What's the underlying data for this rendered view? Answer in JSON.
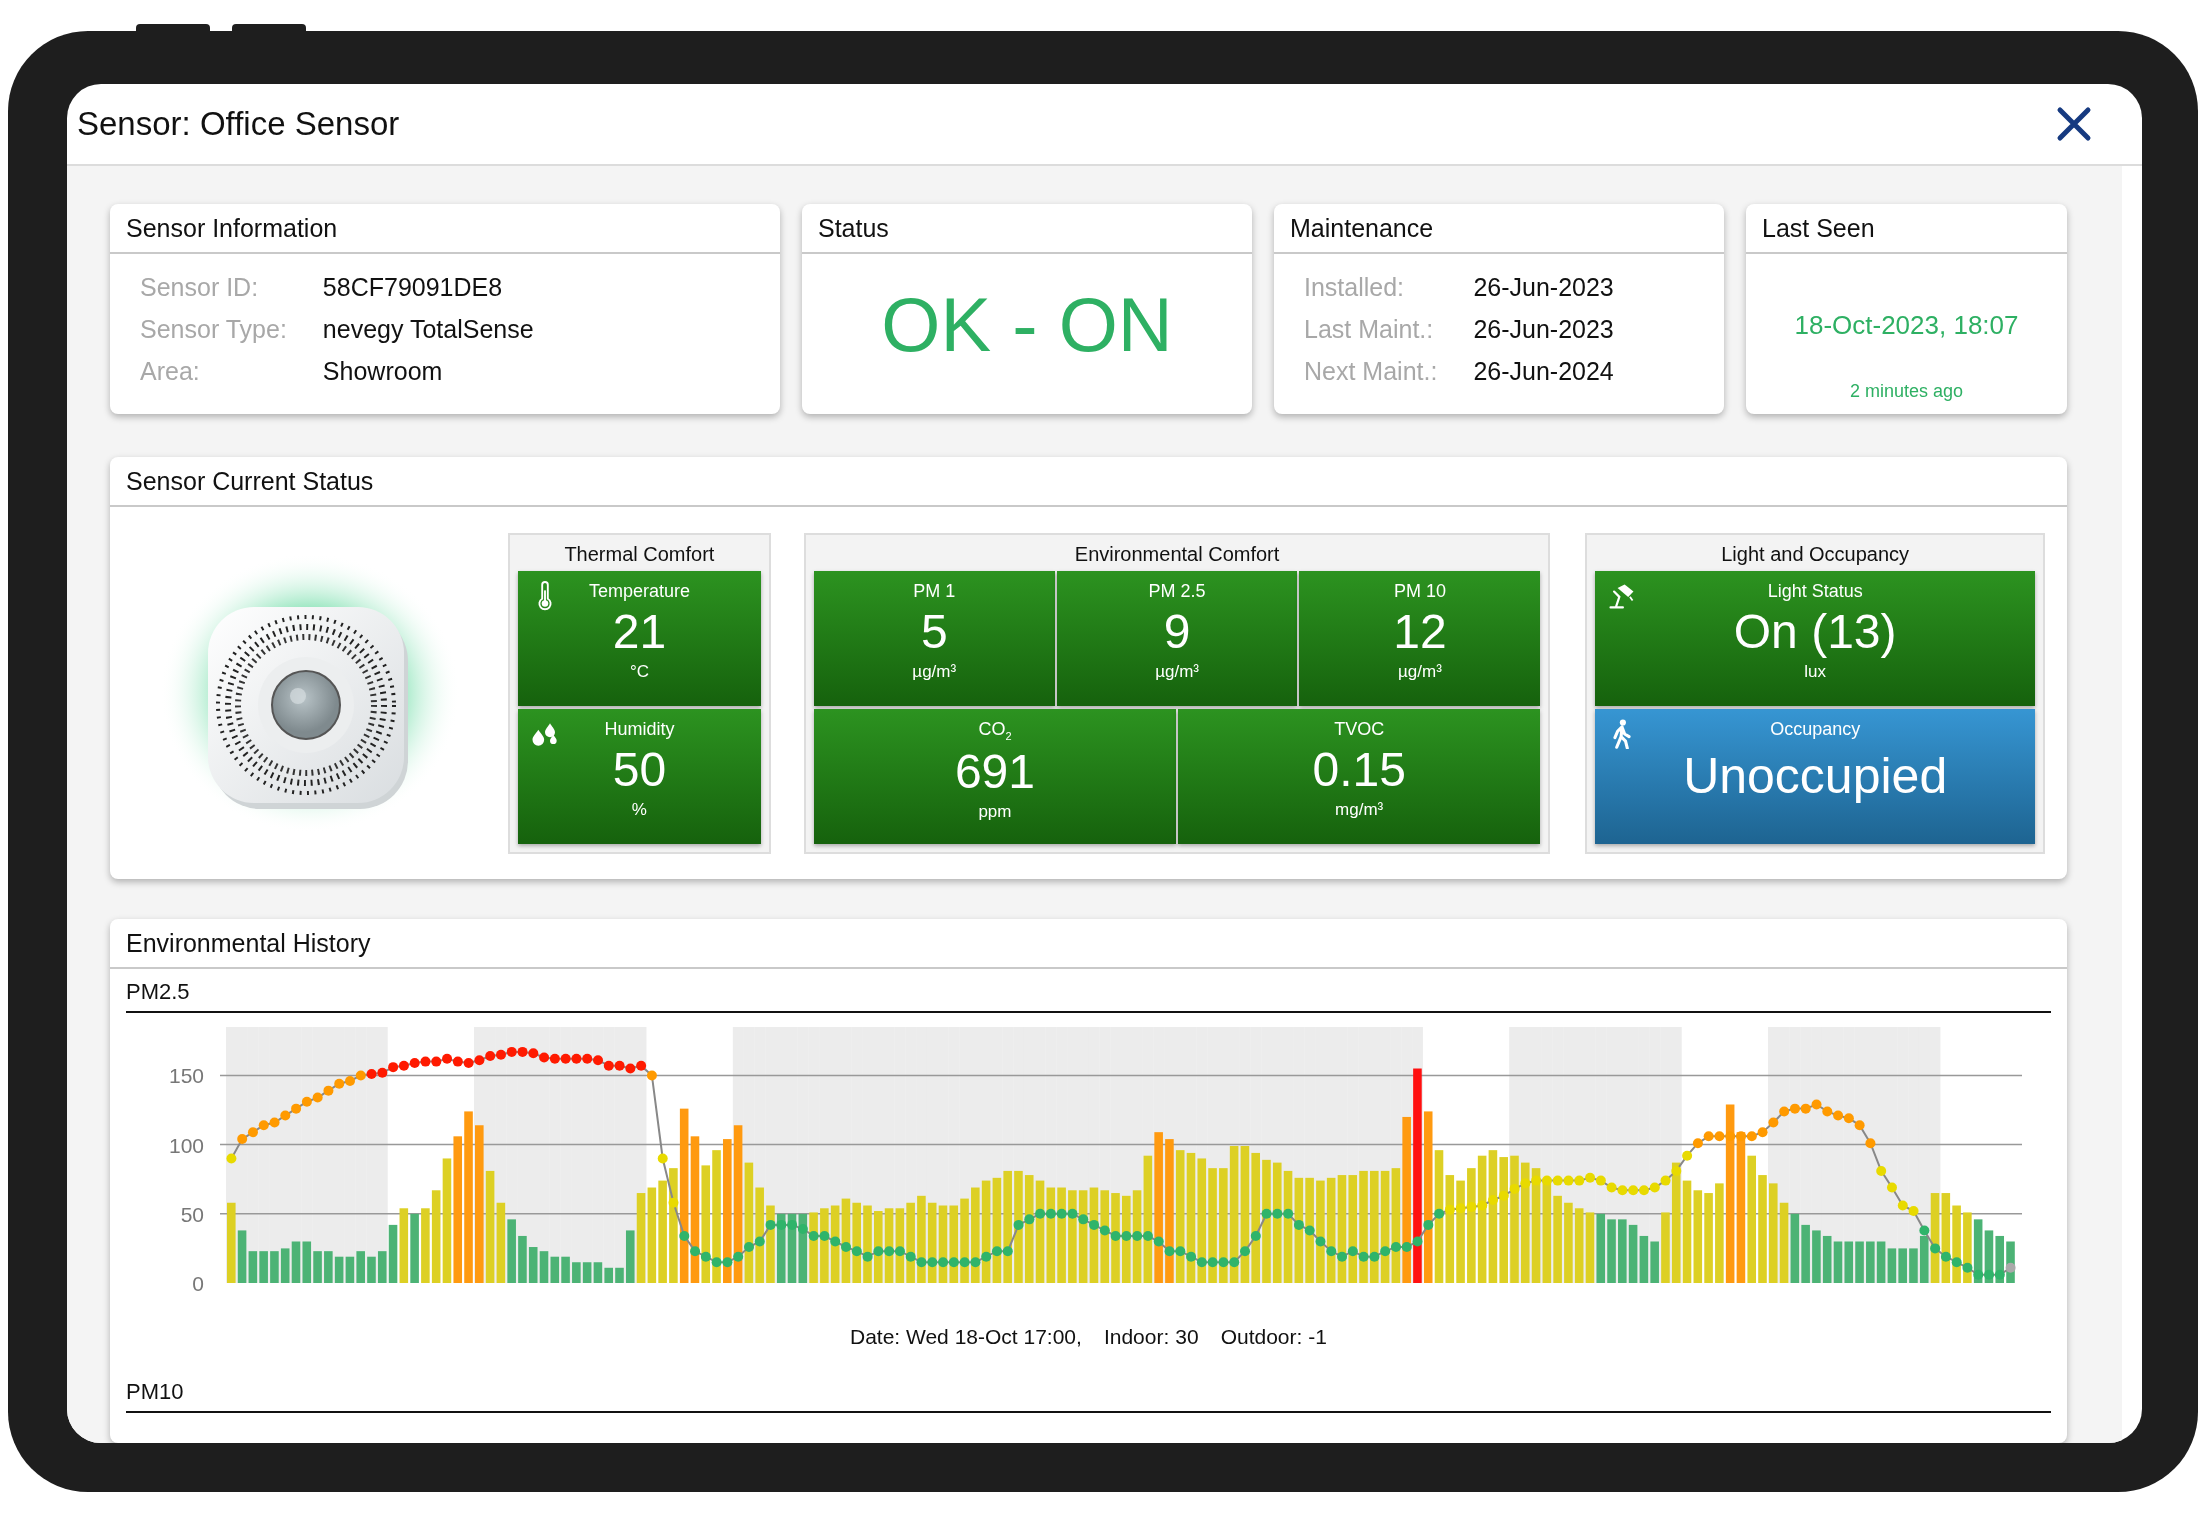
{
  "window": {
    "title": "Sensor: Office Sensor"
  },
  "info_cards": [
    {
      "kind": "fields",
      "title": "Sensor Information",
      "fields": [
        {
          "label": "Sensor ID:",
          "value": "58CF79091DE8"
        },
        {
          "label": "Sensor Type:",
          "value": "nevegy TotalSense"
        },
        {
          "label": "Area:",
          "value": "Showroom"
        }
      ]
    },
    {
      "kind": "status",
      "title": "Status",
      "value": "OK - ON"
    },
    {
      "kind": "fields",
      "title": "Maintenance",
      "fields": [
        {
          "label": "Installed:",
          "value": "26-Jun-2023"
        },
        {
          "label": "Last Maint.:",
          "value": "26-Jun-2023"
        },
        {
          "label": "Next Maint.:",
          "value": "26-Jun-2024"
        }
      ]
    },
    {
      "kind": "last_seen",
      "title": "Last Seen",
      "value": "18-Oct-2023, 18:07",
      "note": "2 minutes ago"
    }
  ],
  "current_status": {
    "title": "Sensor Current Status",
    "groups": [
      {
        "title": "Thermal Comfort",
        "rows": [
          [
            {
              "kind": "temperature",
              "label": "Temperature",
              "value": "21",
              "unit": "°C",
              "color": "#1f8c12"
            }
          ],
          [
            {
              "kind": "humidity",
              "label": "Humidity",
              "value": "50",
              "unit": "%",
              "color": "#1f8c12"
            }
          ]
        ]
      },
      {
        "title": "Environmental Comfort",
        "rows": [
          [
            {
              "kind": "plain",
              "label": "PM 1",
              "value": "5",
              "unit": "µg/m³",
              "color": "#1f8c12"
            },
            {
              "kind": "plain",
              "label": "PM 2.5",
              "value": "9",
              "unit": "µg/m³",
              "color": "#1f8c12"
            },
            {
              "kind": "plain",
              "label": "PM 10",
              "value": "12",
              "unit": "µg/m³",
              "color": "#1f8c12"
            }
          ],
          [
            {
              "kind": "plain",
              "label": "CO$_{2}$",
              "value": "691",
              "unit": "ppm",
              "color": "#1f8c12"
            },
            {
              "kind": "plain",
              "label": "TVOC",
              "value": "0.15",
              "unit": "mg/m³",
              "color": "#1f8c12"
            }
          ]
        ]
      },
      {
        "title": "Light and Occupancy",
        "rows": [
          [
            {
              "kind": "light",
              "label": "Light Status",
              "value": "On (13)",
              "unit": "lux",
              "color": "#1f8c12"
            }
          ],
          [
            {
              "kind": "occupancy",
              "label": "Occupancy",
              "value": "Unoccupied",
              "color": "#2a8fd0"
            }
          ]
        ]
      }
    ]
  },
  "history": {
    "title": "Environmental History",
    "charts": [
      {
        "title": "PM2.5",
        "chart_data": {
          "type": "bar",
          "ylim": [
            0,
            185
          ],
          "yticks": [
            0,
            50,
            100,
            150
          ],
          "grid": true,
          "series": [
            {
              "name": "Indoor:",
              "type": "bar",
              "values": [
                58,
                38,
                23,
                23,
                23,
                25,
                30,
                30,
                23,
                23,
                19,
                19,
                23,
                19,
                23,
                42,
                54,
                50,
                54,
                67,
                90,
                106,
                124,
                114,
                81,
                58,
                46,
                34,
                26,
                23,
                19,
                19,
                15,
                15,
                15,
                11,
                11,
                38,
                65,
                69,
                74,
                83,
                126,
                106,
                85,
                96,
                104,
                114,
                87,
                69,
                56,
                50,
                50,
                50,
                51,
                54,
                56,
                61,
                58,
                56,
                52,
                54,
                54,
                58,
                63,
                58,
                56,
                56,
                61,
                69,
                74,
                76,
                81,
                81,
                78,
                74,
                69,
                69,
                67,
                67,
                69,
                67,
                65,
                63,
                67,
                92,
                109,
                104,
                96,
                94,
                90,
                83,
                83,
                99,
                99,
                94,
                89,
                87,
                81,
                76,
                76,
                74,
                76,
                78,
                78,
                81,
                81,
                81,
                83,
                120,
                155,
                124,
                96,
                78,
                74,
                83,
                92,
                96,
                91,
                92,
                87,
                83,
                74,
                63,
                58,
                54,
                51,
                50,
                46,
                46,
                42,
                34,
                30,
                51,
                87,
                74,
                67,
                65,
                72,
                129,
                109,
                92,
                78,
                72,
                58,
                50,
                42,
                38,
                34,
                30,
                30,
                30,
                30,
                30,
                25,
                25,
                25,
                34,
                65,
                65,
                56,
                51,
                46,
                38,
                34,
                30
              ],
              "colors": [
                "#ddd024",
                "#4cb375",
                "#4cb375",
                "#4cb375",
                "#4cb375",
                "#4cb375",
                "#4cb375",
                "#4cb375",
                "#4cb375",
                "#4cb375",
                "#4cb375",
                "#4cb375",
                "#4cb375",
                "#4cb375",
                "#4cb375",
                "#4cb375",
                "#ddd024",
                "#4cb375",
                "#ddd024",
                "#ddd024",
                "#ddd024",
                "#ff9a10",
                "#ff9a10",
                "#ff9a10",
                "#ddd024",
                "#ddd024",
                "#4cb375",
                "#4cb375",
                "#4cb375",
                "#4cb375",
                "#4cb375",
                "#4cb375",
                "#4cb375",
                "#4cb375",
                "#4cb375",
                "#4cb375",
                "#4cb375",
                "#4cb375",
                "#ddd024",
                "#ddd024",
                "#ddd024",
                "#ddd024",
                "#ff9a10",
                "#ff9a10",
                "#ddd024",
                "#ddd024",
                "#ff9a10",
                "#ff9a10",
                "#ddd024",
                "#ddd024",
                "#ddd024",
                "#4cb375",
                "#4cb375",
                "#4cb375",
                "#ddd024",
                "#ddd024",
                "#ddd024",
                "#ddd024",
                "#ddd024",
                "#ddd024",
                "#ddd024",
                "#ddd024",
                "#ddd024",
                "#ddd024",
                "#ddd024",
                "#ddd024",
                "#ddd024",
                "#ddd024",
                "#ddd024",
                "#ddd024",
                "#ddd024",
                "#ddd024",
                "#ddd024",
                "#ddd024",
                "#ddd024",
                "#ddd024",
                "#ddd024",
                "#ddd024",
                "#ddd024",
                "#ddd024",
                "#ddd024",
                "#ddd024",
                "#ddd024",
                "#ddd024",
                "#ddd024",
                "#ddd024",
                "#ff9a10",
                "#ff9a10",
                "#ddd024",
                "#ddd024",
                "#ddd024",
                "#ddd024",
                "#ddd024",
                "#ddd024",
                "#ddd024",
                "#ddd024",
                "#ddd024",
                "#ddd024",
                "#ddd024",
                "#ddd024",
                "#ddd024",
                "#ddd024",
                "#ddd024",
                "#ddd024",
                "#ddd024",
                "#ddd024",
                "#ddd024",
                "#ddd024",
                "#ddd024",
                "#ff9a10",
                "#ff1010",
                "#ff9a10",
                "#ddd024",
                "#ddd024",
                "#ddd024",
                "#ddd024",
                "#ddd024",
                "#ddd024",
                "#ddd024",
                "#ddd024",
                "#ddd024",
                "#ddd024",
                "#ddd024",
                "#ddd024",
                "#ddd024",
                "#ddd024",
                "#ddd024",
                "#4cb375",
                "#4cb375",
                "#4cb375",
                "#4cb375",
                "#4cb375",
                "#4cb375",
                "#ddd024",
                "#ddd024",
                "#ddd024",
                "#ddd024",
                "#ddd024",
                "#ddd024",
                "#ff9a10",
                "#ff9a10",
                "#ddd024",
                "#ddd024",
                "#ddd024",
                "#ddd024",
                "#4cb375",
                "#4cb375",
                "#4cb375",
                "#4cb375",
                "#4cb375",
                "#4cb375",
                "#4cb375",
                "#4cb375",
                "#4cb375",
                "#4cb375",
                "#4cb375",
                "#4cb375",
                "#4cb375",
                "#ddd024",
                "#ddd024",
                "#ddd024",
                "#ddd024",
                "#4cb375",
                "#4cb375",
                "#4cb375",
                "#4cb375"
              ]
            },
            {
              "name": "Outdoor:",
              "type": "line",
              "color": "#888888",
              "marker": true,
              "values": [
                90,
                104,
                109,
                114,
                116,
                121,
                126,
                131,
                134,
                139,
                144,
                146,
                150,
                151,
                152,
                156,
                157,
                159,
                160,
                160,
                162,
                160,
                159,
                161,
                164,
                165,
                167,
                167,
                166,
                163,
                162,
                162,
                162,
                162,
                161,
                157,
                157,
                155,
                157,
                150,
                90,
                58,
                34,
                23,
                19,
                15,
                15,
                19,
                26,
                30,
                42,
                42,
                42,
                39,
                34,
                34,
                30,
                26,
                23,
                19,
                23,
                23,
                23,
                19,
                15,
                15,
                15,
                15,
                15,
                15,
                19,
                23,
                23,
                42,
                46,
                50,
                50,
                50,
                50,
                46,
                42,
                38,
                34,
                34,
                34,
                34,
                30,
                23,
                23,
                19,
                15,
                15,
                15,
                15,
                23,
                34,
                50,
                50,
                50,
                42,
                38,
                30,
                23,
                19,
                23,
                19,
                19,
                23,
                26,
                26,
                30,
                42,
                50,
                53,
                54,
                55,
                56,
                60,
                63,
                68,
                72,
                74,
                74,
                74,
                74,
                74,
                76,
                74,
                69,
                67,
                67,
                67,
                69,
                74,
                81,
                92,
                101,
                106,
                106,
                106,
                106,
                106,
                109,
                116,
                124,
                126,
                126,
                129,
                124,
                121,
                119,
                114,
                101,
                81,
                69,
                56,
                52,
                38,
                25,
                19,
                15,
                11,
                6,
                6,
                6,
                11
              ],
              "colors": [
                "#e8da00",
                "#ff9a00",
                "#ff9a00",
                "#ff9a00",
                "#ff9a00",
                "#ff9a00",
                "#ff9a00",
                "#ff9a00",
                "#ff9a00",
                "#ff9a00",
                "#ff9a00",
                "#ff9a00",
                "#ff9a00",
                "#ff1a00",
                "#ff1a00",
                "#ff1a00",
                "#ff1a00",
                "#ff1a00",
                "#ff1a00",
                "#ff1a00",
                "#ff1a00",
                "#ff1a00",
                "#ff1a00",
                "#ff1a00",
                "#ff1a00",
                "#ff1a00",
                "#ff1a00",
                "#ff1a00",
                "#ff1a00",
                "#ff1a00",
                "#ff1a00",
                "#ff1a00",
                "#ff1a00",
                "#ff1a00",
                "#ff1a00",
                "#ff1a00",
                "#ff1a00",
                "#ff1a00",
                "#ff1a00",
                "#ff9a00",
                "#e8da00",
                "#e8da00",
                "#2fb46a",
                "#2fb46a",
                "#2fb46a",
                "#2fb46a",
                "#2fb46a",
                "#2fb46a",
                "#2fb46a",
                "#2fb46a",
                "#2fb46a",
                "#2fb46a",
                "#2fb46a",
                "#2fb46a",
                "#2fb46a",
                "#2fb46a",
                "#2fb46a",
                "#2fb46a",
                "#2fb46a",
                "#2fb46a",
                "#2fb46a",
                "#2fb46a",
                "#2fb46a",
                "#2fb46a",
                "#2fb46a",
                "#2fb46a",
                "#2fb46a",
                "#2fb46a",
                "#2fb46a",
                "#2fb46a",
                "#2fb46a",
                "#2fb46a",
                "#2fb46a",
                "#2fb46a",
                "#2fb46a",
                "#2fb46a",
                "#2fb46a",
                "#2fb46a",
                "#2fb46a",
                "#2fb46a",
                "#2fb46a",
                "#2fb46a",
                "#2fb46a",
                "#2fb46a",
                "#2fb46a",
                "#2fb46a",
                "#2fb46a",
                "#2fb46a",
                "#2fb46a",
                "#2fb46a",
                "#2fb46a",
                "#2fb46a",
                "#2fb46a",
                "#2fb46a",
                "#2fb46a",
                "#2fb46a",
                "#2fb46a",
                "#2fb46a",
                "#2fb46a",
                "#2fb46a",
                "#2fb46a",
                "#2fb46a",
                "#2fb46a",
                "#2fb46a",
                "#2fb46a",
                "#2fb46a",
                "#2fb46a",
                "#2fb46a",
                "#2fb46a",
                "#2fb46a",
                "#2fb46a",
                "#2fb46a",
                "#2fb46a",
                "#e8da00",
                "#e8da00",
                "#e8da00",
                "#e8da00",
                "#e8da00",
                "#e8da00",
                "#e8da00",
                "#e8da00",
                "#e8da00",
                "#e8da00",
                "#e8da00",
                "#e8da00",
                "#e8da00",
                "#e8da00",
                "#e8da00",
                "#e8da00",
                "#e8da00",
                "#e8da00",
                "#e8da00",
                "#e8da00",
                "#e8da00",
                "#e8da00",
                "#e8da00",
                "#ff9a00",
                "#ff9a00",
                "#ff9a00",
                "#ff9a00",
                "#ff9a00",
                "#ff9a00",
                "#ff9a00",
                "#ff9a00",
                "#ff9a00",
                "#ff9a00",
                "#ff9a00",
                "#ff9a00",
                "#ff9a00",
                "#ff9a00",
                "#ff9a00",
                "#ff9a00",
                "#ff9a00",
                "#e8da00",
                "#e8da00",
                "#e8da00",
                "#e8da00",
                "#2fb46a",
                "#2fb46a",
                "#2fb46a",
                "#2fb46a",
                "#2fb46a",
                "#2fb46a",
                "#2fb46a",
                "#2fb46a",
                "#aaaaaa"
              ]
            }
          ]
        },
        "shaded": [
          true,
          true,
          true,
          true,
          true,
          true,
          true,
          true,
          true,
          true,
          true,
          true,
          true,
          true,
          true,
          false,
          false,
          false,
          false,
          false,
          false,
          false,
          false,
          true,
          true,
          true,
          true,
          true,
          true,
          true,
          true,
          true,
          true,
          true,
          true,
          true,
          true,
          true,
          true,
          false,
          false,
          false,
          false,
          false,
          false,
          false,
          false,
          true,
          true,
          true,
          true,
          true,
          true,
          true,
          true,
          true,
          true,
          true,
          true,
          true,
          true,
          true,
          true,
          true,
          true,
          true,
          true,
          true,
          true,
          true,
          true,
          true,
          true,
          true,
          true,
          true,
          true,
          true,
          true,
          true,
          true,
          true,
          true,
          true,
          true,
          true,
          true,
          true,
          true,
          true,
          true,
          true,
          true,
          true,
          true,
          true,
          true,
          true,
          true,
          true,
          true,
          true,
          true,
          true,
          true,
          true,
          true,
          true,
          true,
          true,
          true,
          false,
          false,
          false,
          false,
          false,
          false,
          false,
          false,
          true,
          true,
          true,
          true,
          true,
          true,
          true,
          true,
          true,
          true,
          true,
          true,
          true,
          true,
          true,
          true,
          false,
          false,
          false,
          false,
          false,
          false,
          false,
          false,
          true,
          true,
          true,
          true,
          true,
          true,
          true,
          true,
          true,
          true,
          true,
          true,
          true,
          true,
          true,
          true,
          false,
          false,
          false,
          false,
          false,
          false,
          false
        ],
        "readout": {
          "date": "Date: Wed 18-Oct 17:00,",
          "values": [
            "30",
            "-1"
          ]
        }
      },
      {
        "title": "PM10"
      }
    ]
  }
}
